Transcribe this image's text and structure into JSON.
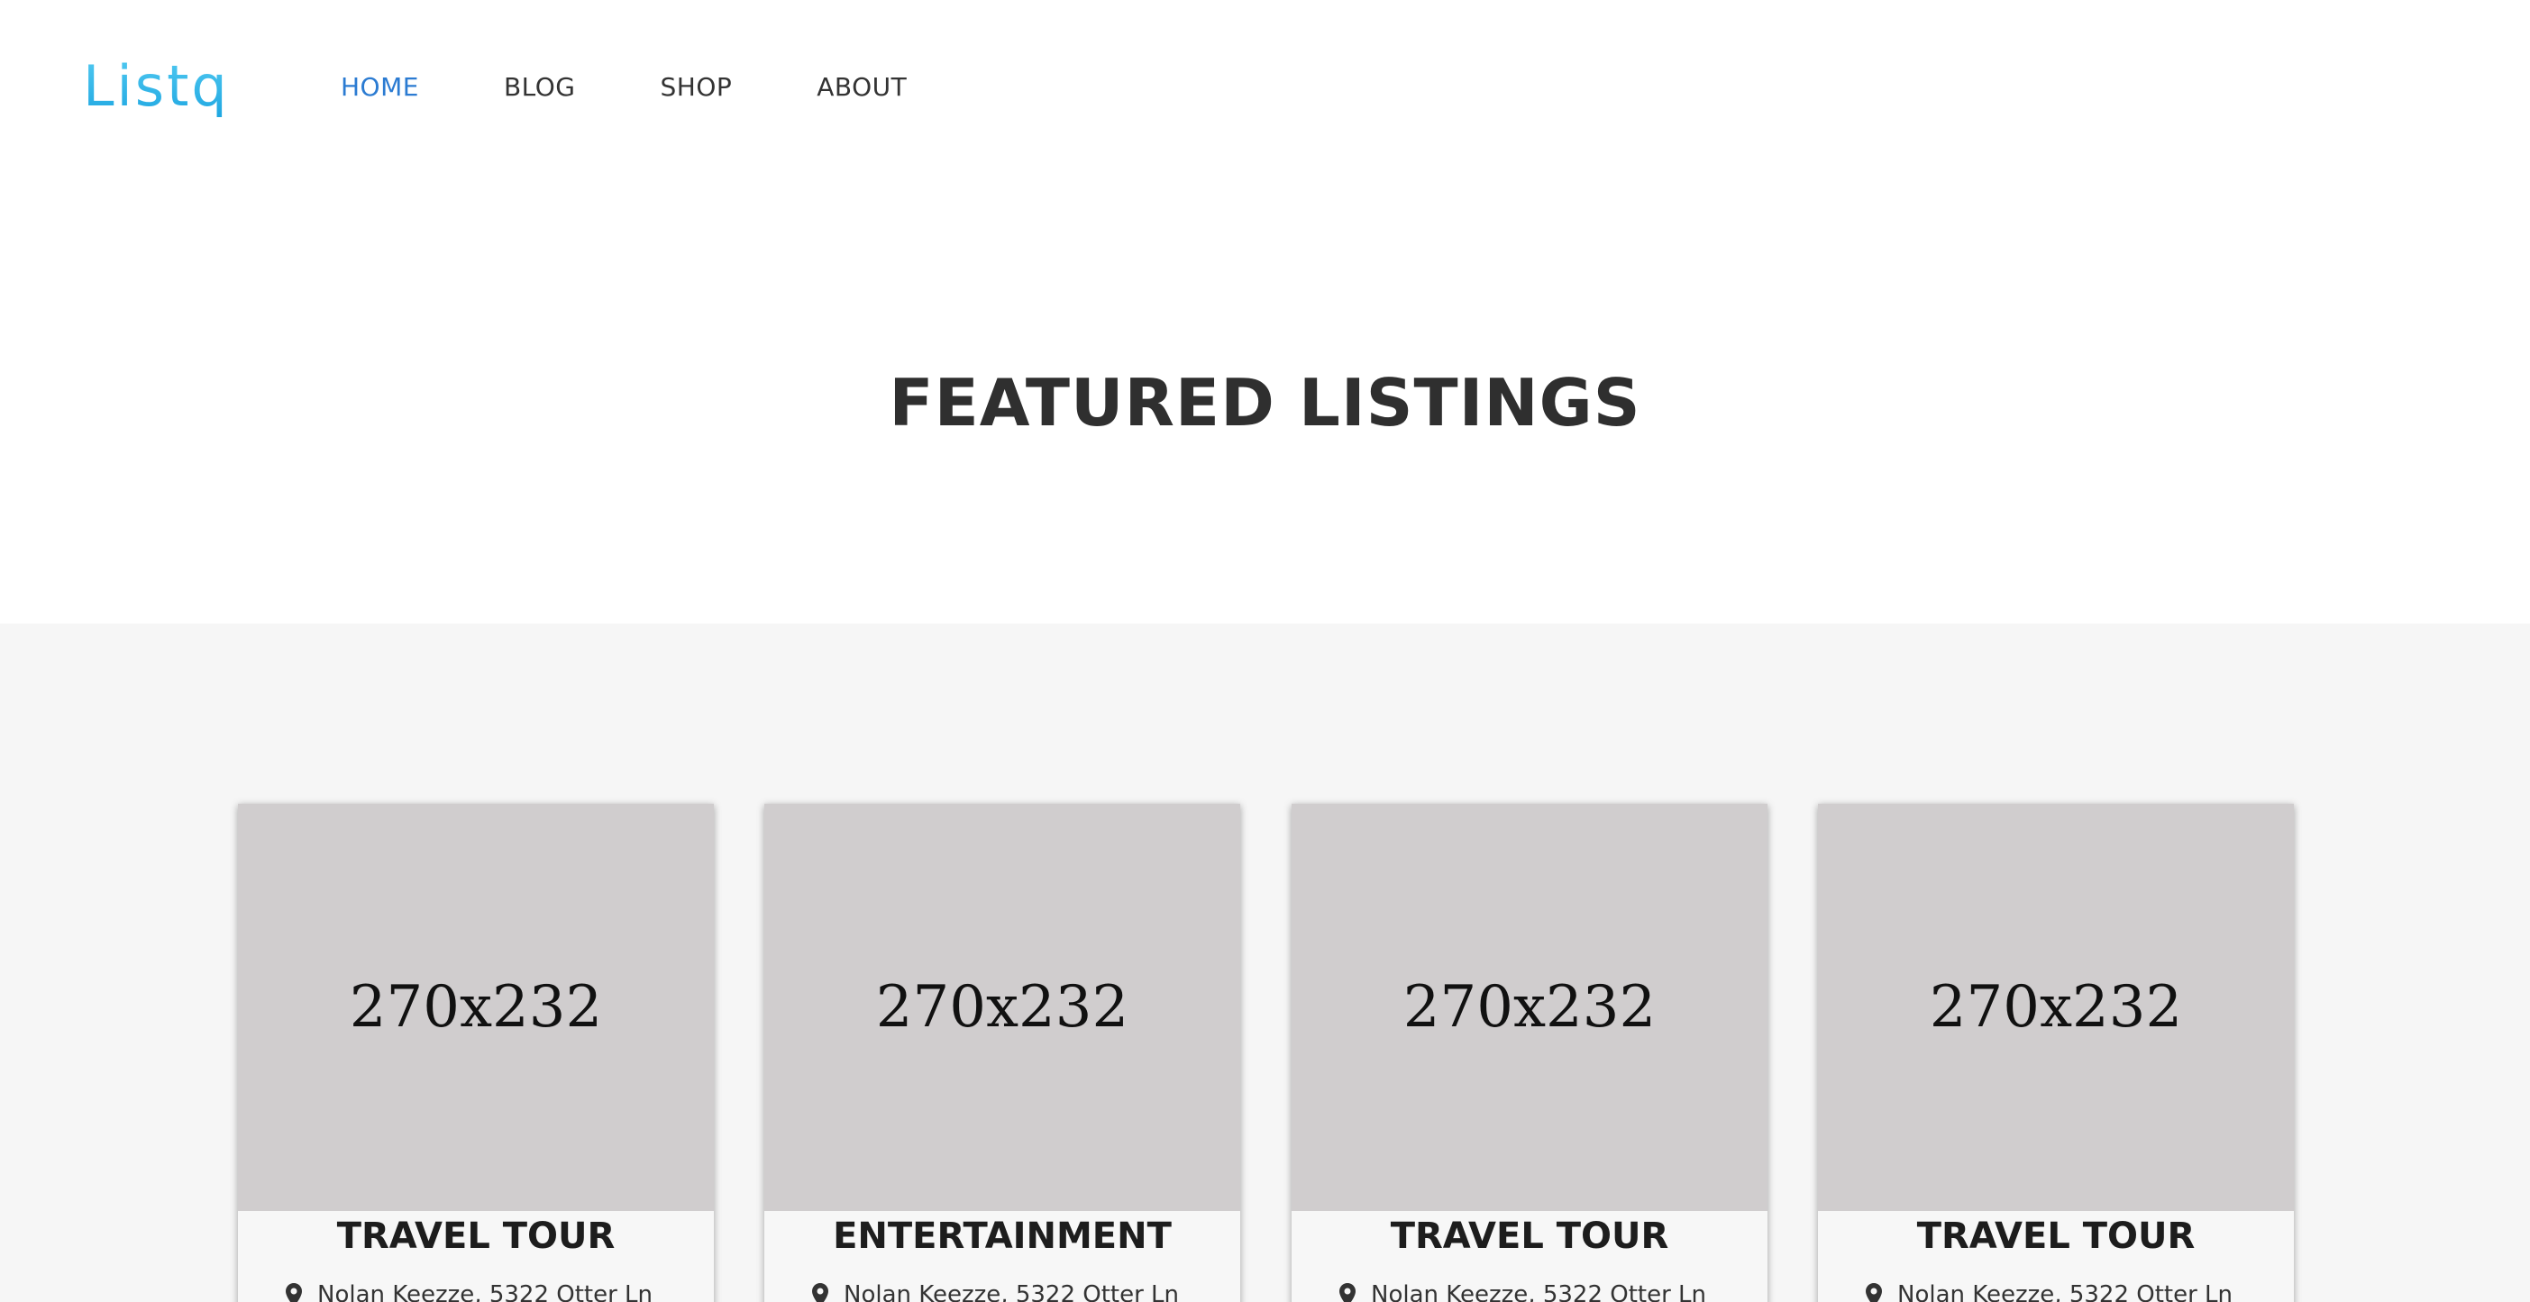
{
  "header": {
    "logo_text": "Listq",
    "nav": [
      {
        "label": "HOME",
        "active": true
      },
      {
        "label": "BLOG",
        "active": false
      },
      {
        "label": "SHOP",
        "active": false
      },
      {
        "label": "ABOUT",
        "active": false
      }
    ]
  },
  "section": {
    "title": "FEATURED LISTINGS"
  },
  "listings": [
    {
      "image_text": "270x232",
      "category": "TRAVEL TOUR",
      "meta": "Nolan Keezze, 5322 Otter Ln",
      "icon": "map-pin-icon"
    },
    {
      "image_text": "270x232",
      "category": "ENTERTAINMENT",
      "meta": "Nolan Keezze, 5322 Otter Ln",
      "icon": "map-pin-icon"
    },
    {
      "image_text": "270x232",
      "category": "TRAVEL TOUR",
      "meta": "Nolan Keezze, 5322 Otter Ln",
      "icon": "map-pin-icon"
    },
    {
      "image_text": "270x232",
      "category": "TRAVEL TOUR",
      "meta": "Nolan Keezze, 5322 Otter Ln",
      "icon": "map-pin-icon"
    }
  ],
  "colors": {
    "accent": "#2b7bd2",
    "logo": "#2bb3e8",
    "section_bg": "#f6f6f6",
    "placeholder": "#d0cdce"
  }
}
